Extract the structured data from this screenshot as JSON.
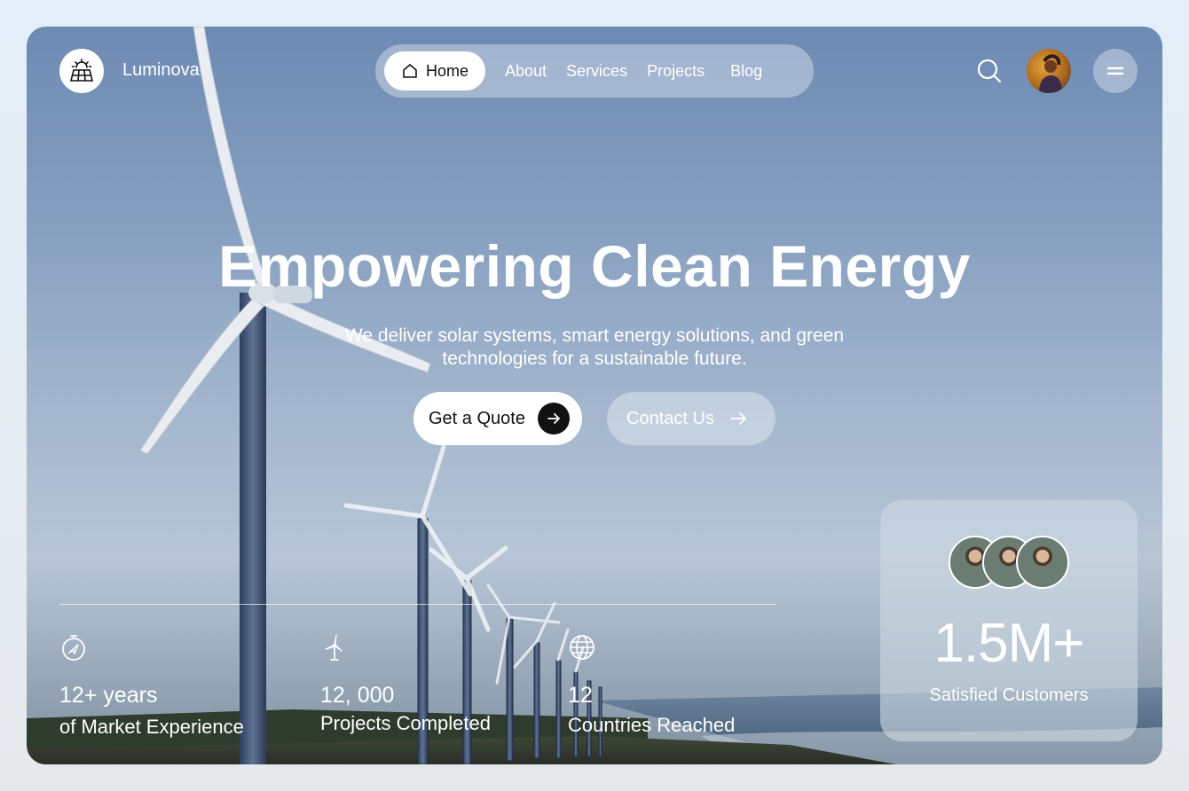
{
  "brand": {
    "name": "Luminova",
    "logo_icon": "solar-panel-icon"
  },
  "nav": {
    "items": [
      {
        "label": "Home",
        "icon": "home-icon",
        "active": true
      },
      {
        "label": "About"
      },
      {
        "label": "Services"
      },
      {
        "label": "Projects"
      },
      {
        "label": "Blog"
      }
    ]
  },
  "header_actions": {
    "search_icon": "search-icon",
    "menu_icon": "menu-icon"
  },
  "hero": {
    "title": "Empowering Clean Energy",
    "subtitle": "We deliver solar systems, smart energy solutions, and green technologies for a sustainable future.",
    "primary_cta": "Get a Quote",
    "secondary_cta": "Contact Us"
  },
  "stats": [
    {
      "icon": "timer-icon",
      "value": "12+ years",
      "label": "of Market Experience"
    },
    {
      "icon": "wind-turbine-icon",
      "value": "12, 000",
      "label": "Projects Completed"
    },
    {
      "icon": "globe-icon",
      "value": "12",
      "label": "Countries Reached"
    }
  ],
  "customers_card": {
    "value": "1.5M+",
    "label": "Satisfied Customers"
  },
  "colors": {
    "accent": "#111111",
    "white": "#ffffff",
    "sky": "#6d8ab3"
  }
}
